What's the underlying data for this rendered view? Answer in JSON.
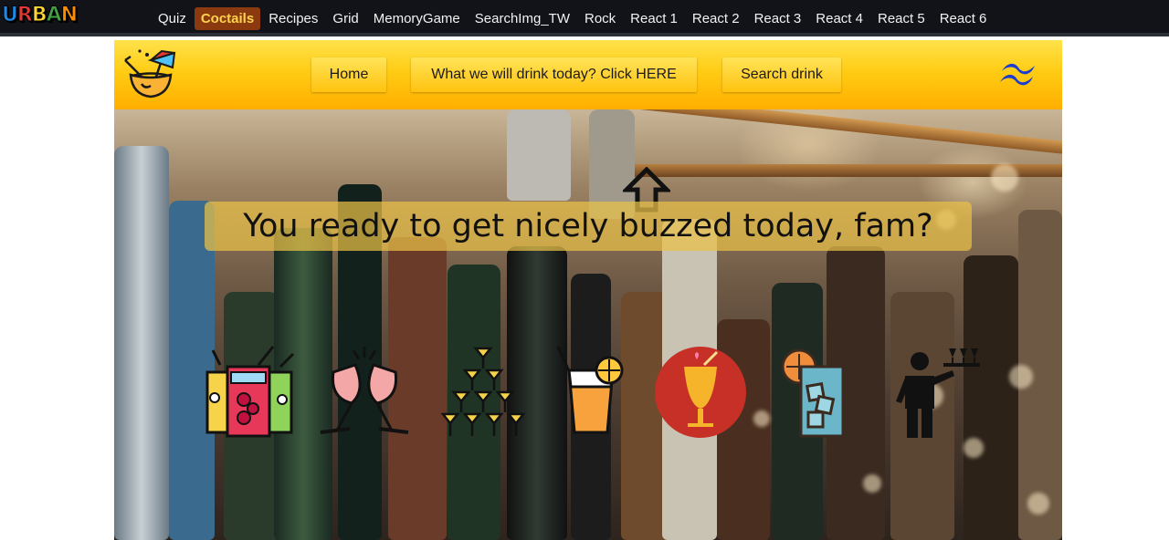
{
  "topnav": {
    "logo_text": "URBAN",
    "items": [
      {
        "label": "Quiz",
        "active": false
      },
      {
        "label": "Coctails",
        "active": true
      },
      {
        "label": "Recipes",
        "active": false
      },
      {
        "label": "Grid",
        "active": false
      },
      {
        "label": "MemoryGame",
        "active": false
      },
      {
        "label": "SearchImg_TW",
        "active": false
      },
      {
        "label": "Rock",
        "active": false
      },
      {
        "label": "React 1",
        "active": false
      },
      {
        "label": "React 2",
        "active": false
      },
      {
        "label": "React 3",
        "active": false
      },
      {
        "label": "React 4",
        "active": false
      },
      {
        "label": "React 5",
        "active": false
      },
      {
        "label": "React 6",
        "active": false
      }
    ]
  },
  "subheader": {
    "home_label": "Home",
    "random_label": "What we will drink today? Click HERE",
    "search_label": "Search drink",
    "left_logo": "coconut-cocktail-icon",
    "right_logo": "tailwind-logo-icon",
    "arrow_icon": "up-arrow-icon"
  },
  "hero": {
    "headline": "You ready to get nicely buzzed today, fam?",
    "icons": [
      "three-cocktails-icon",
      "cheers-glasses-icon",
      "champagne-tower-icon",
      "orange-juice-icon",
      "cocktail-circle-icon",
      "iced-drink-icon",
      "waiter-icon"
    ]
  },
  "colors": {
    "nav_bg": "#111318",
    "accent_yellow": "#ffc20f",
    "active_tab_bg": "#8a3a0e",
    "active_tab_text": "#ffd34d"
  }
}
